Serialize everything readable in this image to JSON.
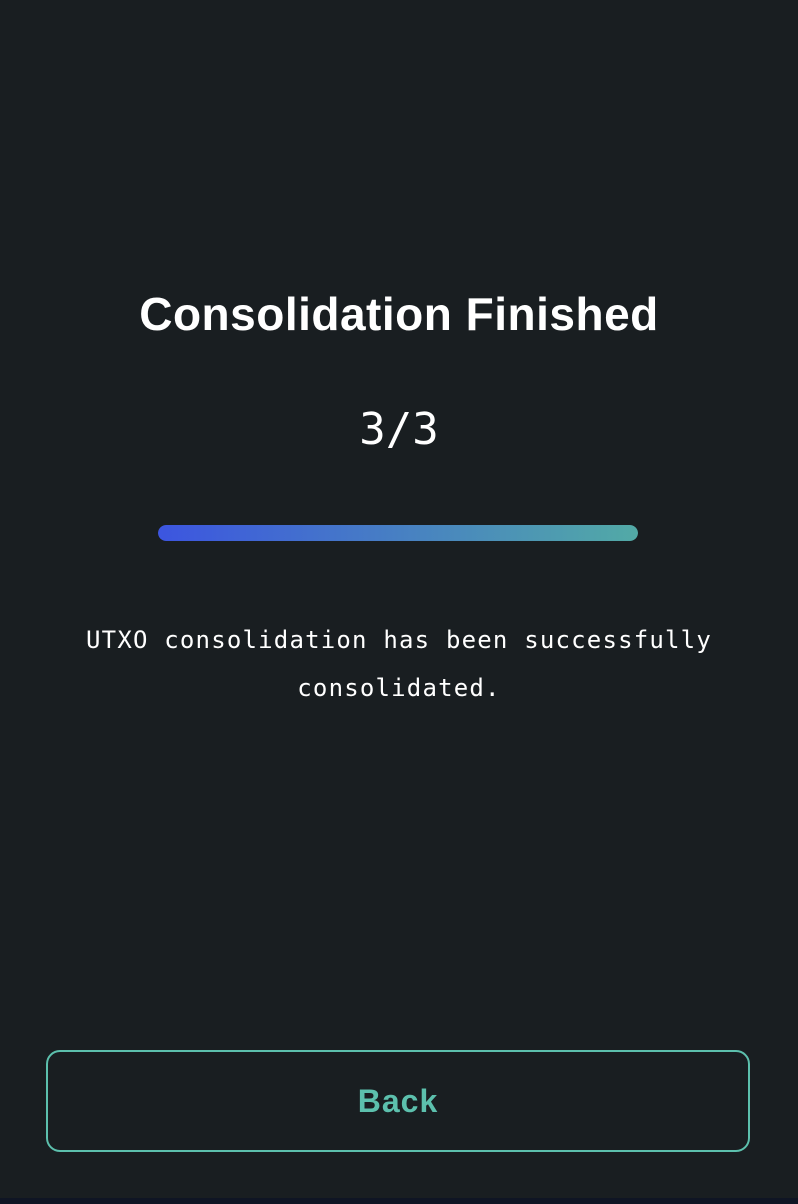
{
  "screen": {
    "title": "Consolidation Finished",
    "step_counter": "3/3",
    "progress": {
      "fraction": 1.0,
      "gradient_start": "#3c55e0",
      "gradient_end": "#52aaa6"
    },
    "message": "UTXO consolidation has been successfully consolidated."
  },
  "actions": {
    "back_label": "Back"
  },
  "colors": {
    "background": "#191e21",
    "accent": "#5cc0ad",
    "text": "#ffffff"
  }
}
